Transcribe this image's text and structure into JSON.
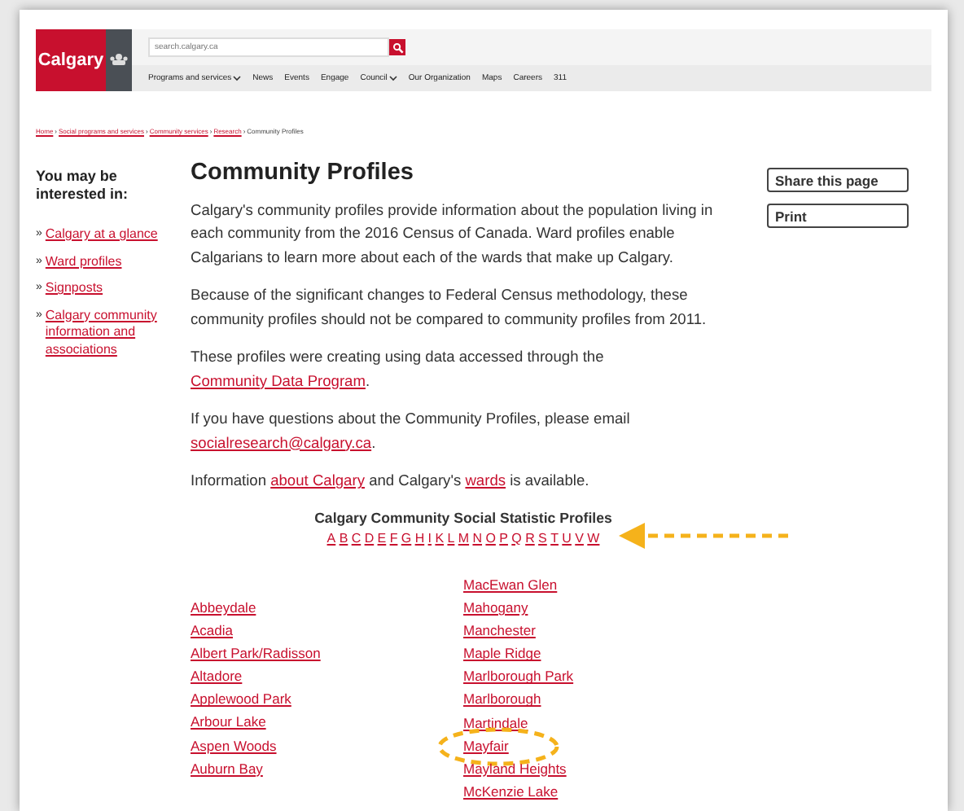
{
  "header": {
    "logo": "Calgary",
    "search": {
      "placeholder": "search.calgary.ca"
    },
    "nav": [
      {
        "label": "Programs and services",
        "dropdown": true
      },
      {
        "label": "News",
        "dropdown": false
      },
      {
        "label": "Events",
        "dropdown": false
      },
      {
        "label": "Engage",
        "dropdown": false
      },
      {
        "label": "Council",
        "dropdown": true
      },
      {
        "label": "Our Organization",
        "dropdown": false
      },
      {
        "label": "Maps",
        "dropdown": false
      },
      {
        "label": "Careers",
        "dropdown": false
      },
      {
        "label": "311",
        "dropdown": false
      }
    ]
  },
  "breadcrumb": [
    {
      "label": "Home",
      "kind": "link"
    },
    {
      "separator": "›",
      "label": "Social programs and services",
      "kind": "link"
    },
    {
      "separator": "›",
      "label": "Community services",
      "kind": "link"
    },
    {
      "separator": "›",
      "label": "Research",
      "kind": "link"
    },
    {
      "separator": "›",
      "label": "Community Profiles",
      "kind": "current"
    }
  ],
  "sidebar": {
    "heading": "You may be interested in:",
    "links": [
      {
        "bullet": "»",
        "label": "Calgary at a glance"
      },
      {
        "bullet": "»",
        "label": "Ward profiles"
      },
      {
        "bullet": "»",
        "label": "Signposts"
      },
      {
        "bullet": "»",
        "label": "Calgary community information and associations"
      }
    ]
  },
  "title": "Community Profiles",
  "paragraphs": [
    [
      {
        "text": "Calgary's community profiles provide information about the population living in each community from the 2016 Census of Canada. Ward profiles enable Calgarians to learn more about each of the wards that make up Calgary.",
        "kind": "text"
      }
    ],
    [
      {
        "text": "Because of the significant changes to Federal Census methodology, these community profiles should not be compared to community profiles from 2011.",
        "kind": "text"
      }
    ],
    [
      {
        "text": "These profiles were creating using data accessed through the ",
        "kind": "text"
      },
      {
        "text": "Community Data Program",
        "kind": "link"
      },
      {
        "text": ".",
        "kind": "text"
      }
    ],
    [
      {
        "text": "If you have questions about the Community Profiles, please email ",
        "kind": "text"
      },
      {
        "text": "socialresearch@calgary.ca",
        "kind": "link"
      },
      {
        "text": ".",
        "kind": "text"
      }
    ],
    [
      {
        "text": "Information ",
        "kind": "text"
      },
      {
        "text": "about Calgary",
        "kind": "link"
      },
      {
        "text": " and Calgary's ",
        "kind": "text"
      },
      {
        "text": "wards",
        "kind": "link"
      },
      {
        "text": " is available.",
        "kind": "text"
      }
    ]
  ],
  "actions": [
    "Share this page",
    "Print"
  ],
  "profiles": {
    "heading": "Calgary Community Social Statistic Profiles",
    "letters": [
      "A",
      "B",
      "C",
      "D",
      "E",
      "F",
      "G",
      "H",
      "I",
      "K",
      "L",
      "M",
      "N",
      "O",
      "P",
      "Q",
      "R",
      "S",
      "T",
      "U",
      "V",
      "W"
    ],
    "pointer_arrow": true
  },
  "communities": {
    "column_1": [
      {
        "name": "Abbeydale",
        "highlighted": false
      },
      {
        "name": "Acadia",
        "highlighted": false
      },
      {
        "name": "Albert Park/Radisson",
        "highlighted": false
      },
      {
        "name": "Altadore",
        "highlighted": false
      },
      {
        "name": "Applewood Park",
        "highlighted": false
      },
      {
        "name": "Arbour Lake",
        "highlighted": false
      },
      {
        "name": "Aspen Woods",
        "highlighted": false
      },
      {
        "name": "Auburn Bay",
        "highlighted": false
      }
    ],
    "column_2": [
      {
        "name": "MacEwan Glen",
        "highlighted": false
      },
      {
        "name": "Mahogany",
        "highlighted": false
      },
      {
        "name": "Manchester",
        "highlighted": false
      },
      {
        "name": "Maple Ridge",
        "highlighted": false
      },
      {
        "name": "Marlborough Park",
        "highlighted": false
      },
      {
        "name": "Marlborough",
        "highlighted": false
      },
      {
        "name": "Martindale",
        "highlighted": false
      },
      {
        "name": "Mayfair",
        "highlighted": true
      },
      {
        "name": "Mayland Heights",
        "highlighted": false
      },
      {
        "name": "McKenzie Lake",
        "highlighted": false
      }
    ]
  }
}
